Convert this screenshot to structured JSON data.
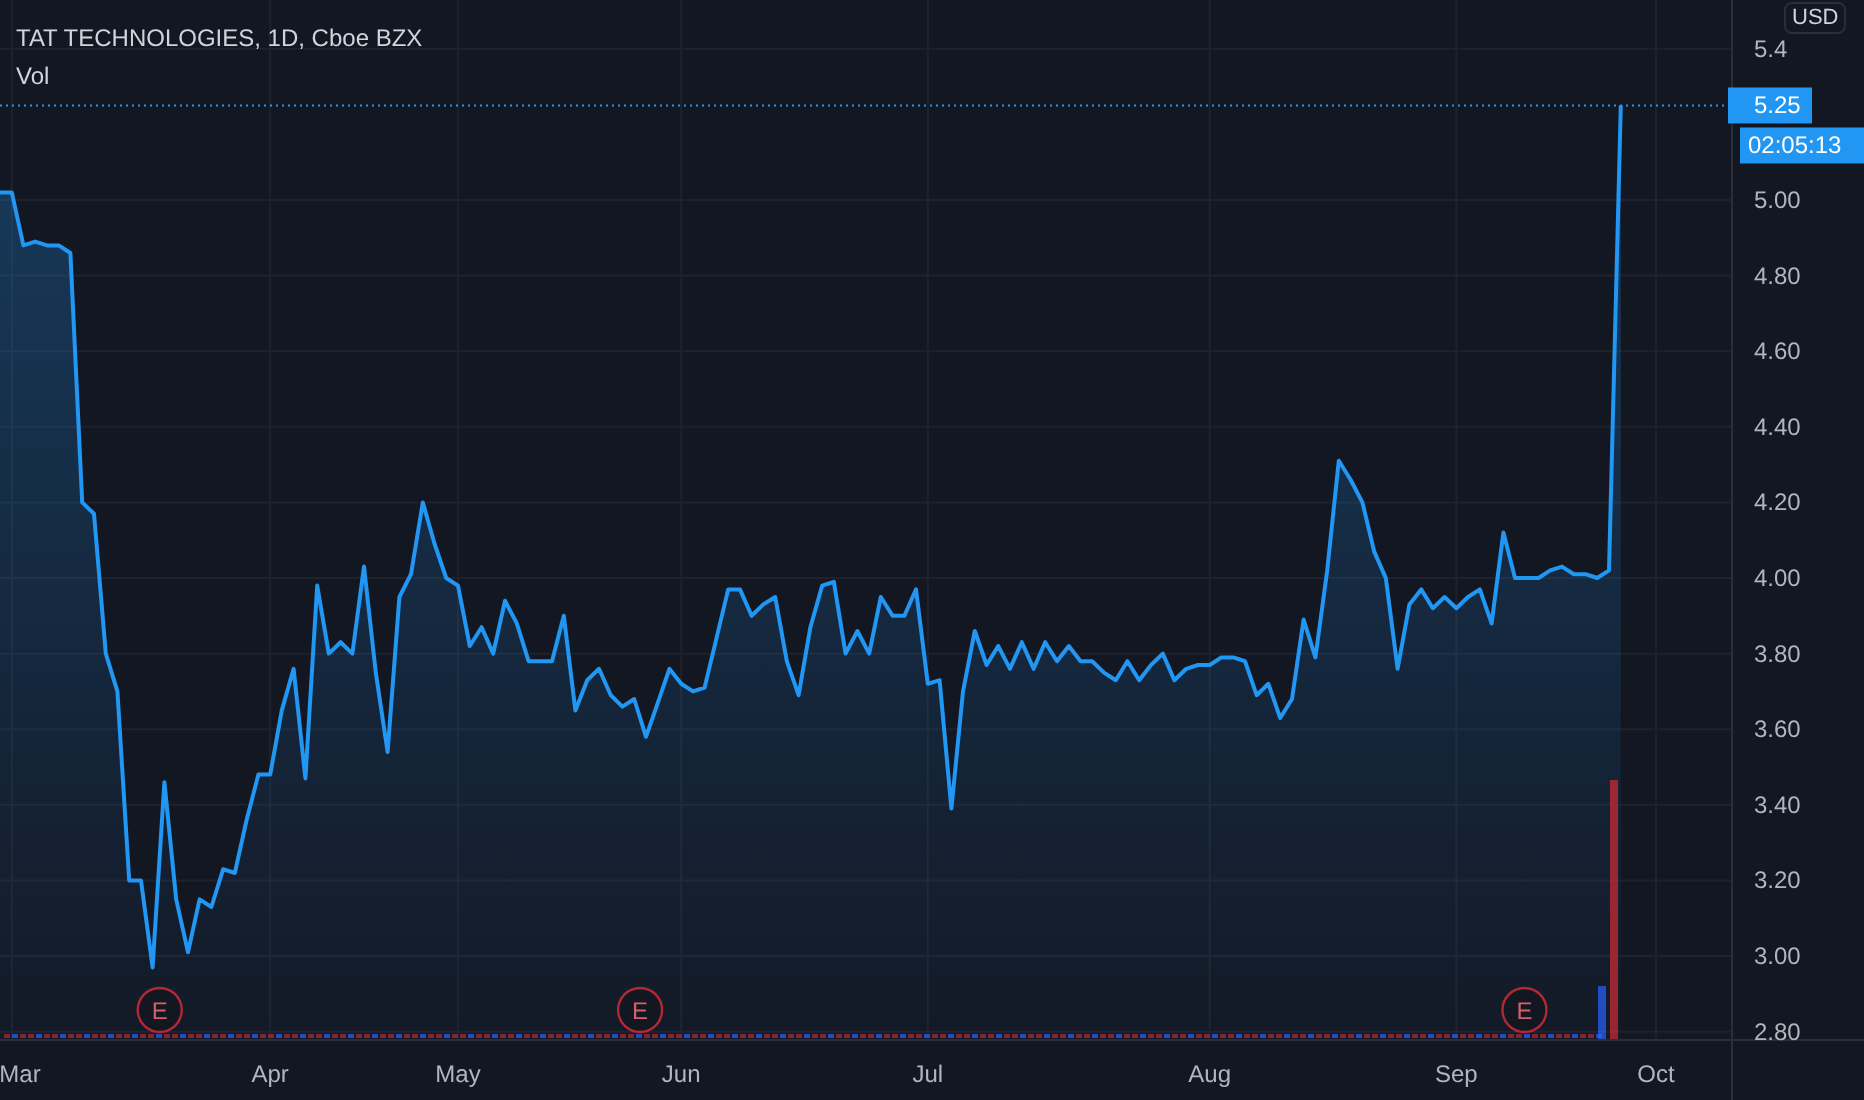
{
  "legend": {
    "title": "TAT TECHNOLOGIES, 1D, Cboe BZX",
    "volume_label": "Vol"
  },
  "currency": "USD",
  "last_price": {
    "countdown": "02:05:13"
  },
  "earnings": [
    {
      "label": "E"
    },
    {
      "label": "E"
    },
    {
      "label": "E"
    }
  ],
  "chart_data": {
    "type": "area",
    "grid": true,
    "ylim": [
      2.778,
      5.529
    ],
    "ref_lines": [
      {
        "axis": "y",
        "value": 5.25,
        "label": "5.25",
        "color": "#2196f3"
      }
    ],
    "yticks": [
      {
        "value": 2.8,
        "label": "2.80"
      },
      {
        "value": 3.0,
        "label": "3.00"
      },
      {
        "value": 3.2,
        "label": "3.20"
      },
      {
        "value": 3.4,
        "label": "3.40"
      },
      {
        "value": 3.6,
        "label": "3.60"
      },
      {
        "value": 3.8,
        "label": "3.80"
      },
      {
        "value": 4.0,
        "label": "4.00"
      },
      {
        "value": 4.2,
        "label": "4.20"
      },
      {
        "value": 4.4,
        "label": "4.40"
      },
      {
        "value": 4.6,
        "label": "4.60"
      },
      {
        "value": 4.8,
        "label": "4.80"
      },
      {
        "value": 5.0,
        "label": "5.00"
      },
      {
        "value": 5.4,
        "label": "5.4"
      }
    ],
    "categories": [
      null,
      "Mar",
      null,
      null,
      null,
      null,
      null,
      null,
      null,
      null,
      null,
      null,
      null,
      null,
      null,
      null,
      null,
      null,
      null,
      null,
      null,
      null,
      null,
      "Apr",
      null,
      null,
      null,
      null,
      null,
      null,
      null,
      null,
      null,
      null,
      null,
      null,
      null,
      null,
      null,
      "May",
      null,
      null,
      null,
      null,
      null,
      null,
      null,
      null,
      null,
      null,
      null,
      null,
      null,
      null,
      null,
      null,
      null,
      null,
      "Jun",
      null,
      null,
      null,
      null,
      null,
      null,
      null,
      null,
      null,
      null,
      null,
      null,
      null,
      null,
      null,
      null,
      null,
      null,
      null,
      null,
      "Jul",
      null,
      null,
      null,
      null,
      null,
      null,
      null,
      null,
      null,
      null,
      null,
      null,
      null,
      null,
      null,
      null,
      null,
      null,
      null,
      null,
      null,
      null,
      null,
      "Aug",
      null,
      null,
      null,
      null,
      null,
      null,
      null,
      null,
      null,
      null,
      null,
      null,
      null,
      null,
      null,
      null,
      null,
      null,
      null,
      null,
      "Sep",
      null,
      null,
      null,
      null,
      null,
      null,
      null,
      null,
      null,
      null,
      null,
      null,
      null,
      null,
      null,
      null,
      "Oct"
    ],
    "series": [
      {
        "color": "#2196f3",
        "values": [
          5.02,
          5.02,
          4.88,
          4.89,
          4.88,
          4.88,
          4.86,
          4.2,
          4.17,
          3.8,
          3.7,
          3.2,
          3.2,
          2.97,
          3.46,
          3.15,
          3.01,
          3.15,
          3.13,
          3.23,
          3.22,
          3.36,
          3.48,
          3.48,
          3.65,
          3.76,
          3.47,
          3.98,
          3.8,
          3.83,
          3.8,
          4.03,
          3.75,
          3.54,
          3.95,
          4.01,
          4.2,
          4.09,
          4.0,
          3.98,
          3.82,
          3.87,
          3.8,
          3.94,
          3.88,
          3.78,
          3.78,
          3.78,
          3.9,
          3.65,
          3.73,
          3.76,
          3.69,
          3.66,
          3.68,
          3.58,
          3.67,
          3.76,
          3.72,
          3.7,
          3.71,
          3.84,
          3.97,
          3.97,
          3.9,
          3.93,
          3.95,
          3.78,
          3.69,
          3.87,
          3.98,
          3.99,
          3.8,
          3.86,
          3.8,
          3.95,
          3.9,
          3.9,
          3.97,
          3.72,
          3.73,
          3.39,
          3.7,
          3.86,
          3.77,
          3.82,
          3.76,
          3.83,
          3.76,
          3.83,
          3.78,
          3.82,
          3.78,
          3.78,
          3.75,
          3.73,
          3.78,
          3.73,
          3.77,
          3.8,
          3.73,
          3.76,
          3.77,
          3.77,
          3.79,
          3.79,
          3.78,
          3.69,
          3.72,
          3.63,
          3.68,
          3.89,
          3.79,
          4.02,
          4.31,
          4.26,
          4.2,
          4.07,
          4.0,
          3.76,
          3.93,
          3.97,
          3.92,
          3.95,
          3.92,
          3.95,
          3.97,
          3.88,
          4.12,
          4.0,
          4.0,
          4.0,
          4.02,
          4.03,
          4.01,
          4.01,
          4.0,
          4.02,
          5.25,
          null,
          null,
          null
        ]
      }
    ]
  }
}
